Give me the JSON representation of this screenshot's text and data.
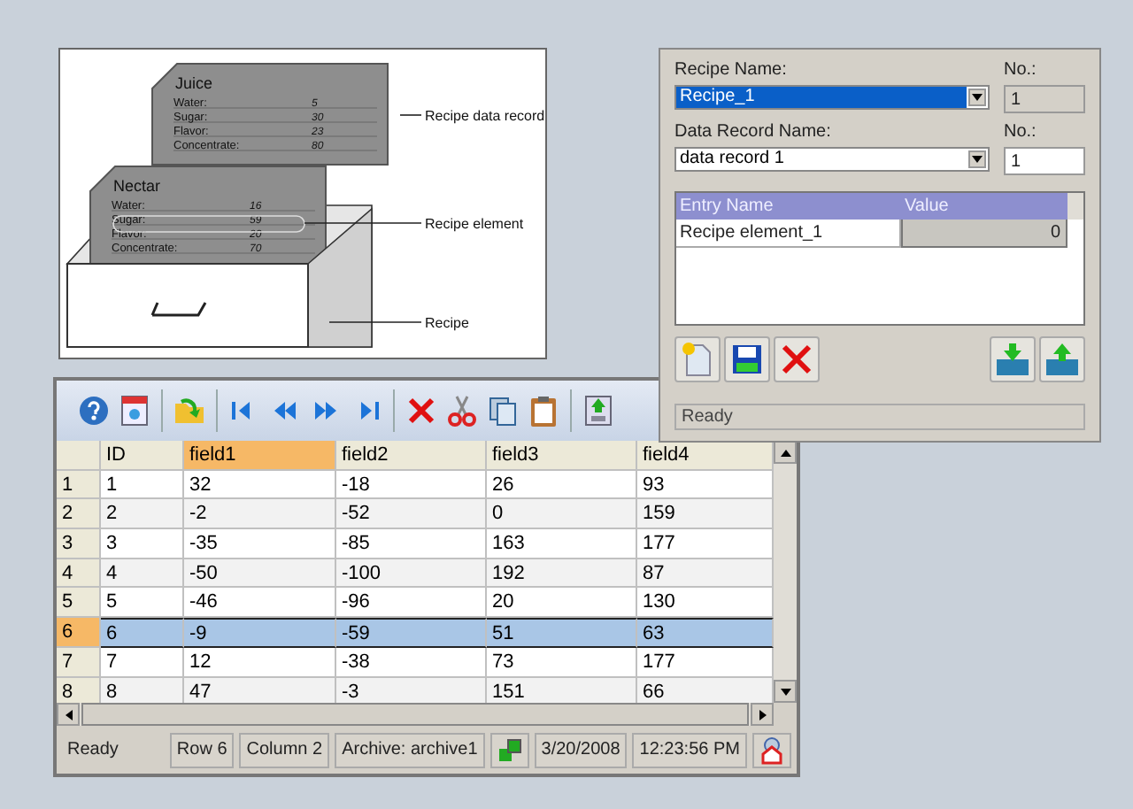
{
  "diagram": {
    "cards": [
      {
        "title": "Juice",
        "entries": [
          {
            "name": "Water:",
            "value": "5"
          },
          {
            "name": "Sugar:",
            "value": "30"
          },
          {
            "name": "Flavor:",
            "value": "23"
          },
          {
            "name": "Concentrate:",
            "value": "80"
          }
        ]
      },
      {
        "title": "Nectar",
        "entries": [
          {
            "name": "Water:",
            "value": "16"
          },
          {
            "name": "Sugar:",
            "value": "59"
          },
          {
            "name": "Flavor:",
            "value": "20"
          },
          {
            "name": "Concentrate:",
            "value": "70"
          }
        ]
      }
    ],
    "callouts": [
      "Recipe data record",
      "Recipe element",
      "Recipe"
    ]
  },
  "recipe_panel": {
    "recipe_name": {
      "label": "Recipe Name:",
      "value": "Recipe_1",
      "focused": true
    },
    "recipe_no": {
      "label": "No.:",
      "value": "1",
      "disabled": true
    },
    "record_name": {
      "label": "Data Record Name:",
      "value": "data record 1",
      "focused": false
    },
    "record_no": {
      "label": "No.:",
      "value": "1",
      "disabled": false
    },
    "table": {
      "columns": [
        "Entry Name",
        "Value"
      ],
      "rows": [
        {
          "name": "Recipe element_1",
          "value": "0"
        }
      ]
    },
    "status": "Ready"
  },
  "data_table": {
    "columns": [
      {
        "label": "ID",
        "selected": false
      },
      {
        "label": "field1",
        "selected": true
      },
      {
        "label": "field2",
        "selected": false
      },
      {
        "label": "field3",
        "selected": false
      },
      {
        "label": "field4",
        "selected": false
      }
    ],
    "rows": [
      {
        "header": "1",
        "cells": [
          "1",
          "32",
          "-18",
          "26",
          "93"
        ],
        "selected": false
      },
      {
        "header": "2",
        "cells": [
          "2",
          "-2",
          "-52",
          "0",
          "159"
        ],
        "selected": false
      },
      {
        "header": "3",
        "cells": [
          "3",
          "-35",
          "-85",
          "163",
          "177"
        ],
        "selected": false
      },
      {
        "header": "4",
        "cells": [
          "4",
          "-50",
          "-100",
          "192",
          "87"
        ],
        "selected": false
      },
      {
        "header": "5",
        "cells": [
          "5",
          "-46",
          "-96",
          "20",
          "130"
        ],
        "selected": false
      },
      {
        "header": "6",
        "cells": [
          "6",
          "-9",
          "-59",
          "51",
          "63"
        ],
        "selected": true
      },
      {
        "header": "7",
        "cells": [
          "7",
          "12",
          "-38",
          "73",
          "177"
        ],
        "selected": false
      },
      {
        "header": "8",
        "cells": [
          "8",
          "47",
          "-3",
          "151",
          "66"
        ],
        "selected": false
      }
    ],
    "status_bar": {
      "message": "Ready",
      "row": "Row 6",
      "column": "Column 2",
      "archive": "Archive: archive1",
      "date": "3/20/2008",
      "time": "12:23:56 PM"
    }
  }
}
